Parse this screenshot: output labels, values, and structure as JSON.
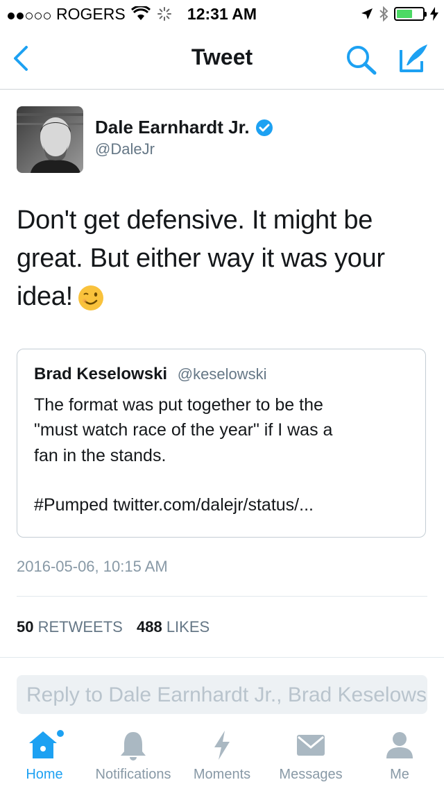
{
  "status_bar": {
    "carrier": "ROGERS",
    "time": "12:31 AM",
    "battery_level": 0.6
  },
  "nav": {
    "title": "Tweet",
    "back_icon": "chevron-left-icon",
    "search_icon": "search-icon",
    "compose_icon": "compose-icon",
    "accent_color": "#1da1f2"
  },
  "tweet": {
    "author_name": "Dale Earnhardt Jr.",
    "author_handle": "@DaleJr",
    "verified": true,
    "text_lines": [
      "Don't get defensive. It might be",
      "great. But either way it was your",
      "idea!"
    ],
    "emoji": "winking-face-emoji",
    "quoted": {
      "author_name": "Brad Keselowski",
      "author_handle": "@keselowski",
      "lines": [
        "The format was put together to be the",
        "\"must watch race of the year\" if I was a",
        "fan in the stands.",
        "#Pumped twitter.com/dalejr/status/..."
      ]
    },
    "timestamp": "2016-05-06, 10:15 AM",
    "retweets_count": "50",
    "retweets_label": "RETWEETS",
    "likes_count": "488",
    "likes_label": "LIKES"
  },
  "reply": {
    "placeholder": "Reply to Dale Earnhardt Jr., Brad Keselowski"
  },
  "tabs": [
    {
      "label": "Home",
      "icon": "home-icon",
      "active": true
    },
    {
      "label": "Notifications",
      "icon": "bell-icon",
      "active": false
    },
    {
      "label": "Moments",
      "icon": "lightning-icon",
      "active": false
    },
    {
      "label": "Messages",
      "icon": "envelope-icon",
      "active": false
    },
    {
      "label": "Me",
      "icon": "person-icon",
      "active": false
    }
  ]
}
